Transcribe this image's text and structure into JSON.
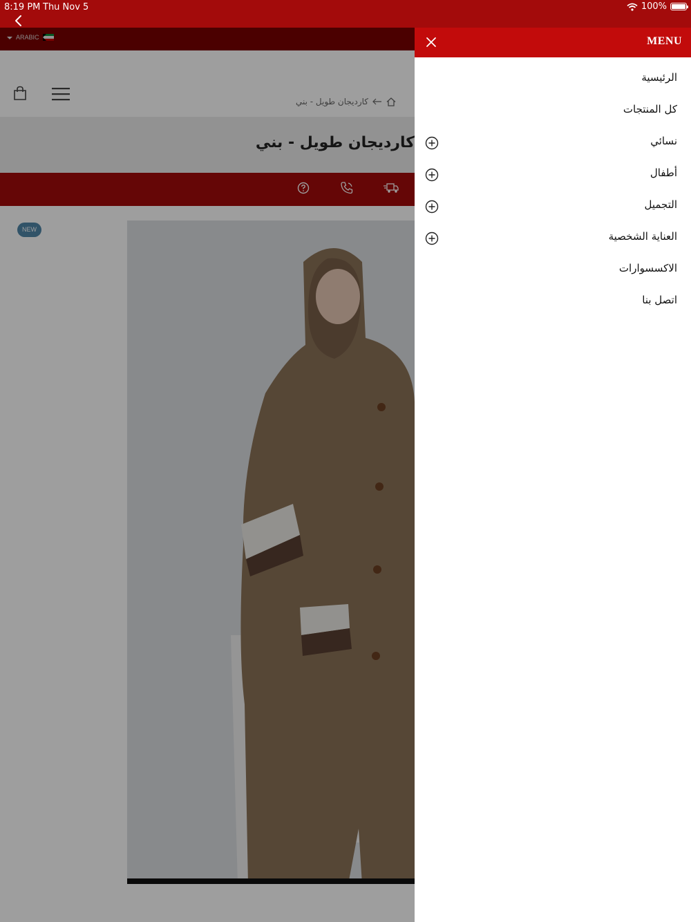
{
  "status_bar": {
    "time": "8:19 PM",
    "date": "Thu Nov 5",
    "battery": "100%",
    "battery_level": 1.0
  },
  "lang_bar": {
    "language": "ARABIC",
    "flag": "kuwait-flag"
  },
  "breadcrumb": {
    "current": "كارديجان طويل - بني"
  },
  "product": {
    "title": "كارديجان طويل - بني",
    "badge": "NEW"
  },
  "drawer": {
    "title": "MENU",
    "items": [
      {
        "label": "الرئيسية",
        "expandable": false
      },
      {
        "label": "كل المنتجات",
        "expandable": false
      },
      {
        "label": "نسائي",
        "expandable": true
      },
      {
        "label": "أطفال",
        "expandable": true
      },
      {
        "label": "التجميل",
        "expandable": true
      },
      {
        "label": "العناية الشخصية",
        "expandable": true
      },
      {
        "label": "الاكسسوارات",
        "expandable": false
      },
      {
        "label": "اتصل بنا",
        "expandable": false
      }
    ]
  },
  "colors": {
    "brand_red": "#c20b0b",
    "dark_red": "#7a0000",
    "badge_blue": "#4f86a9"
  }
}
